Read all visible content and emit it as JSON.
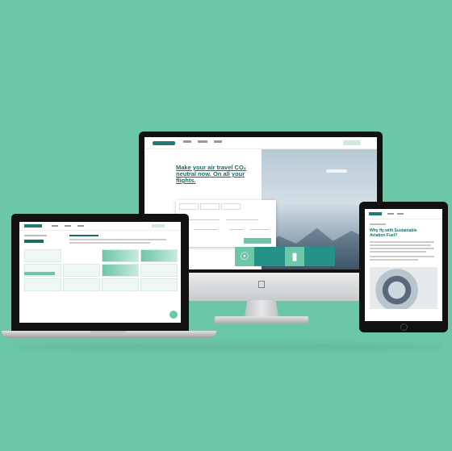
{
  "desktop": {
    "hero_title": "Make your air travel CO₂ neutral now. On all your flights."
  },
  "tablet": {
    "article_title": "Why fly with Sustainable Aviation Fuel?"
  },
  "colors": {
    "background": "#6cc6a8",
    "brand_dark": "#1b6b68",
    "brand_accent": "#25928a"
  }
}
